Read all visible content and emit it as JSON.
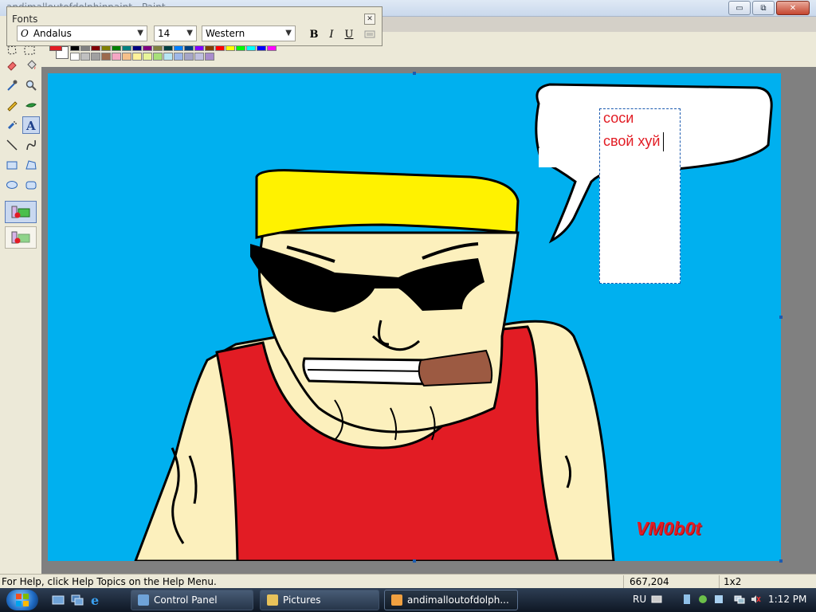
{
  "window": {
    "title": "andimalloutofdolphinpaint - Paint",
    "controls": {
      "minimize": "▭",
      "maximize": "⧉",
      "close": "✕"
    }
  },
  "fonts_toolbar": {
    "title": "Fonts",
    "close_label": "✕",
    "font_icon_glyph": "O",
    "font_name": "Andalus",
    "font_size": "14",
    "script": "Western",
    "bold_label": "B",
    "italic_label": "I",
    "underline_label": "U"
  },
  "toolbox": {
    "tools": [
      "free-select",
      "select",
      "eraser",
      "fill",
      "pick-color",
      "magnifier",
      "pencil",
      "brush",
      "airbrush",
      "text",
      "line",
      "curve",
      "rectangle",
      "polygon",
      "ellipse",
      "rounded-rectangle"
    ],
    "selected_tool": "text",
    "text_background_mode": "opaque"
  },
  "palette": {
    "primary_color": "#e21c24",
    "secondary_color": "#ffffff",
    "colors_row1": [
      "#000000",
      "#808080",
      "#800000",
      "#808000",
      "#008000",
      "#008080",
      "#000080",
      "#800080",
      "#808040",
      "#004040",
      "#0080ff",
      "#004080",
      "#8000ff",
      "#804000",
      "#ff0000",
      "#ffff00",
      "#00ff00",
      "#00ffff",
      "#0000ff",
      "#ff00ff"
    ],
    "colors_row2": [
      "#ffffff",
      "#c0c0c0",
      "#a0a0a0",
      "#9c6a4e",
      "#f4a6c4",
      "#f5c08a",
      "#fff29a",
      "#e8f59a",
      "#a8e07a",
      "#b8e6f4",
      "#9fb8e8",
      "#a6a6c8",
      "#c0c0e0",
      "#a88ccc"
    ]
  },
  "canvas": {
    "background_color": "#00b0ef",
    "speech_text_line1": "соси",
    "speech_text_line2": "свой хуй",
    "signature": "VM0b0t"
  },
  "statusbar": {
    "help_text": "For Help, click Help Topics on the Help Menu.",
    "coordinates": "667,204",
    "selection_size": "1x2"
  },
  "taskbar": {
    "tasks": [
      {
        "label": "Control Panel",
        "icon": "control-panel-icon",
        "active": false
      },
      {
        "label": "Pictures",
        "icon": "folder-icon",
        "active": false
      },
      {
        "label": "andimalloutofdolph...",
        "icon": "paint-icon",
        "active": true
      }
    ],
    "language": "RU",
    "clock": "1:12 PM"
  }
}
